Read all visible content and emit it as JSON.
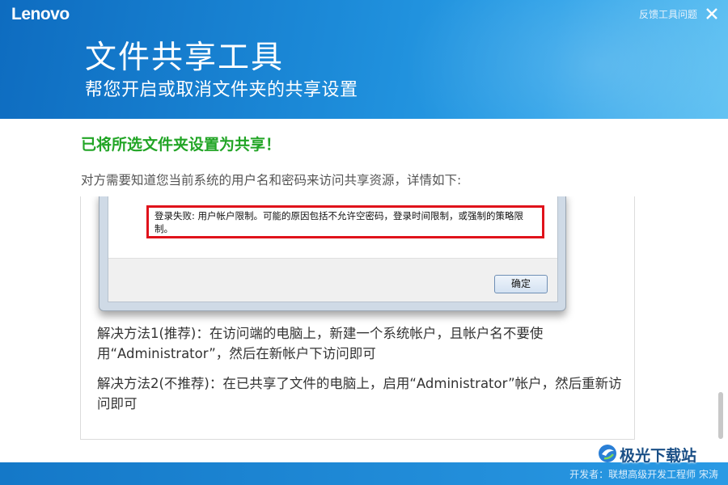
{
  "header": {
    "brand": "Lenovo",
    "feedback_link": "反馈工具问题",
    "title": "文件共享工具",
    "subtitle": "帮您开启或取消文件夹的共享设置"
  },
  "main": {
    "success_message": "已将所选文件夹设置为共享！",
    "instruction": "对方需要知道您当前系统的用户名和密码来访问共享资源，详情如下:",
    "dialog": {
      "error_text": "登录失败: 用户帐户限制。可能的原因包括不允许空密码，登录时间限制，或强制的策略限制。",
      "ok_label": "确定"
    },
    "methods": [
      "解决方法1(推荐)：在访问端的电脑上，新建一个系统帐户，且帐户名不要使用“Administrator”，然后在新帐户下访问即可",
      "解决方法2(不推荐)：在已共享了文件的电脑上，启用“Administrator”帐户，然后重新访问即可"
    ]
  },
  "footer": {
    "developer": "开发者：联想高级开发工程师 宋涛"
  },
  "watermark": {
    "text": "极光下载站"
  },
  "colors": {
    "header_blue": "#1c8ad8",
    "success_green": "#22a526",
    "error_border_red": "#e0121b",
    "footer_blue": "#1478c8"
  }
}
